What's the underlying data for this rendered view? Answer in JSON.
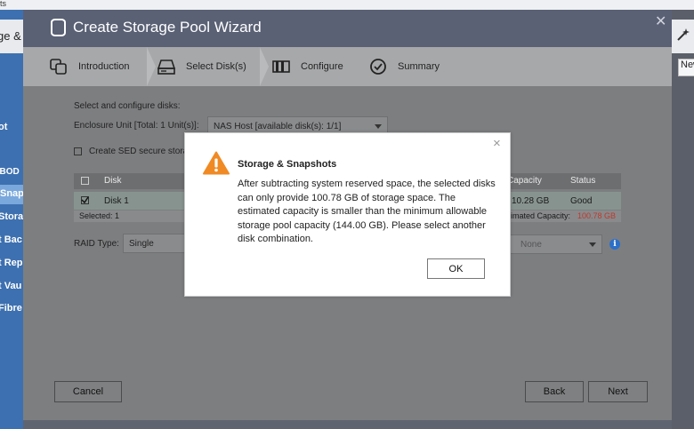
{
  "background": {
    "topbar_text": "ts",
    "left_header": "ge &",
    "sidebar_items": [
      "ot",
      "JBOD",
      "Snap",
      "Stora",
      "t Bac",
      "t Rep",
      "t Vau",
      "Fibre"
    ],
    "right_new_label": "New"
  },
  "wizard": {
    "title": "Create Storage Pool Wizard",
    "steps": [
      {
        "label": "Introduction",
        "icon": "introduction-icon"
      },
      {
        "label": "Select Disk(s)",
        "icon": "disk-icon"
      },
      {
        "label": "Configure",
        "icon": "configure-icon"
      },
      {
        "label": "Summary",
        "icon": "summary-check-icon"
      }
    ],
    "section_title": "Select and configure disks:",
    "enclosure_label": "Enclosure Unit [Total: 1 Unit(s)]:",
    "enclosure_value": "NAS Host [available disk(s): 1/1]",
    "sed_label": "Create SED secure storag",
    "table": {
      "columns": [
        "Disk",
        "Capacity",
        "Status"
      ],
      "rows": [
        {
          "disk": "Disk 1",
          "capacity": "10.28 GB",
          "status": "Good"
        }
      ],
      "selected_label": "Selected: 1",
      "estimated_label": "stimated Capacity:",
      "estimated_value": "100.78 GB"
    },
    "raid_label": "RAID Type:",
    "raid_value": "Single",
    "spare_value": "None",
    "cancel_label": "Cancel",
    "back_label": "Back",
    "next_label": "Next"
  },
  "dialog": {
    "title": "Storage & Snapshots",
    "message": "After subtracting system reserved space, the selected disks can only provide 100.78 GB of storage space. The estimated capacity is smaller than the minimum allowable storage pool capacity (144.00 GB). Please select another disk combination.",
    "ok_label": "OK",
    "close_symbol": "×"
  },
  "colors": {
    "warning": "#f08a24",
    "estimated_value": "#c0392b",
    "info": "#2c6fc9"
  }
}
